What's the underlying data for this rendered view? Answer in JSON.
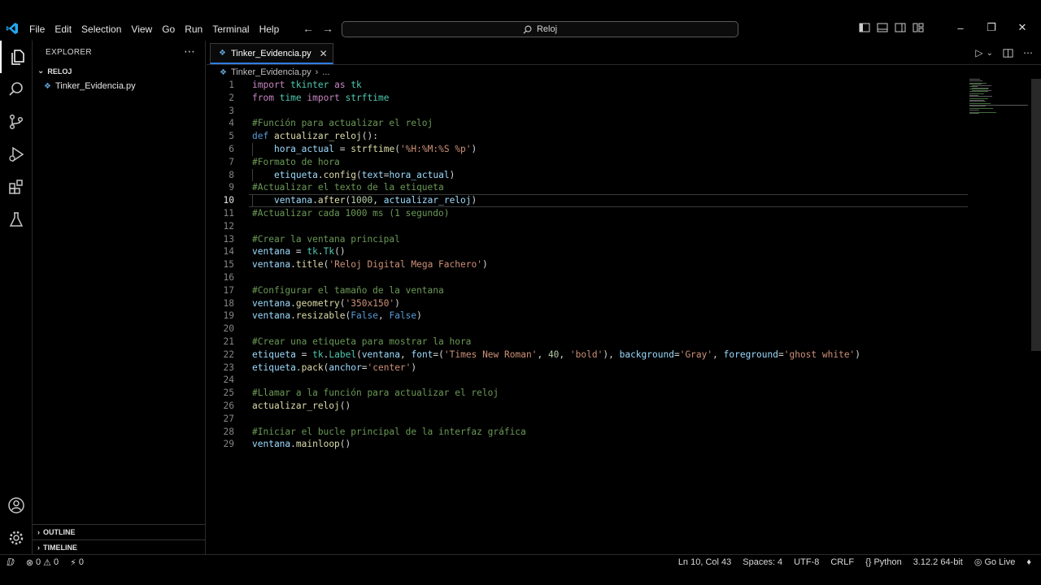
{
  "titlebar": {
    "menu": [
      "File",
      "Edit",
      "Selection",
      "View",
      "Go",
      "Run",
      "Terminal",
      "Help"
    ],
    "search_text": "Reloj",
    "back_glyph": "←",
    "forward_glyph": "→"
  },
  "sidebar": {
    "header": "EXPLORER",
    "folder": "RELOJ",
    "file": "Tinker_Evidencia.py",
    "outline": "OUTLINE",
    "timeline": "TIMELINE"
  },
  "editor": {
    "tab_label": "Tinker_Evidencia.py",
    "breadcrumb_file": "Tinker_Evidencia.py",
    "breadcrumb_more": "...",
    "current_line": 10,
    "lines": [
      "import tkinter as tk",
      "from time import strftime",
      "",
      "#Función para actualizar el reloj",
      "def actualizar_reloj():",
      "    hora_actual = strftime('%H:%M:%S %p')",
      "#Formato de hora",
      "    etiqueta.config(text=hora_actual)",
      "#Actualizar el texto de la etiqueta",
      "    ventana.after(1000, actualizar_reloj)",
      "#Actualizar cada 1000 ms (1 segundo)",
      "",
      "#Crear la ventana principal",
      "ventana = tk.Tk()",
      "ventana.title('Reloj Digital Mega Fachero')",
      "",
      "#Configurar el tamaño de la ventana",
      "ventana.geometry('350x150')",
      "ventana.resizable(False, False)",
      "",
      "#Crear una etiqueta para mostrar la hora",
      "etiqueta = tk.Label(ventana, font=('Times New Roman', 40, 'bold'), background='Gray', foreground='ghost white')",
      "etiqueta.pack(anchor='center')",
      "",
      "#Llamar a la función para actualizar el reloj",
      "actualizar_reloj()",
      "",
      "#Iniciar el bucle principal de la interfaz gráfica",
      "ventana.mainloop()"
    ]
  },
  "statusbar": {
    "errors": "0",
    "warnings": "0",
    "ports": "0",
    "position": "Ln 10, Col 43",
    "spaces": "Spaces: 4",
    "encoding": "UTF-8",
    "eol": "CRLF",
    "language": "Python",
    "interpreter": "3.12.2 64-bit",
    "golive": "Go Live"
  },
  "colors": {
    "keyword": "#c586c0",
    "keyword_def": "#569cd6",
    "function": "#dcdcaa",
    "string": "#ce9178",
    "number": "#b5cea8",
    "variable": "#9cdcfe",
    "class": "#4ec9b0",
    "comment": "#6a9955",
    "tab_accent": "#2f7de1",
    "logo_blue": "#23a9f2"
  }
}
